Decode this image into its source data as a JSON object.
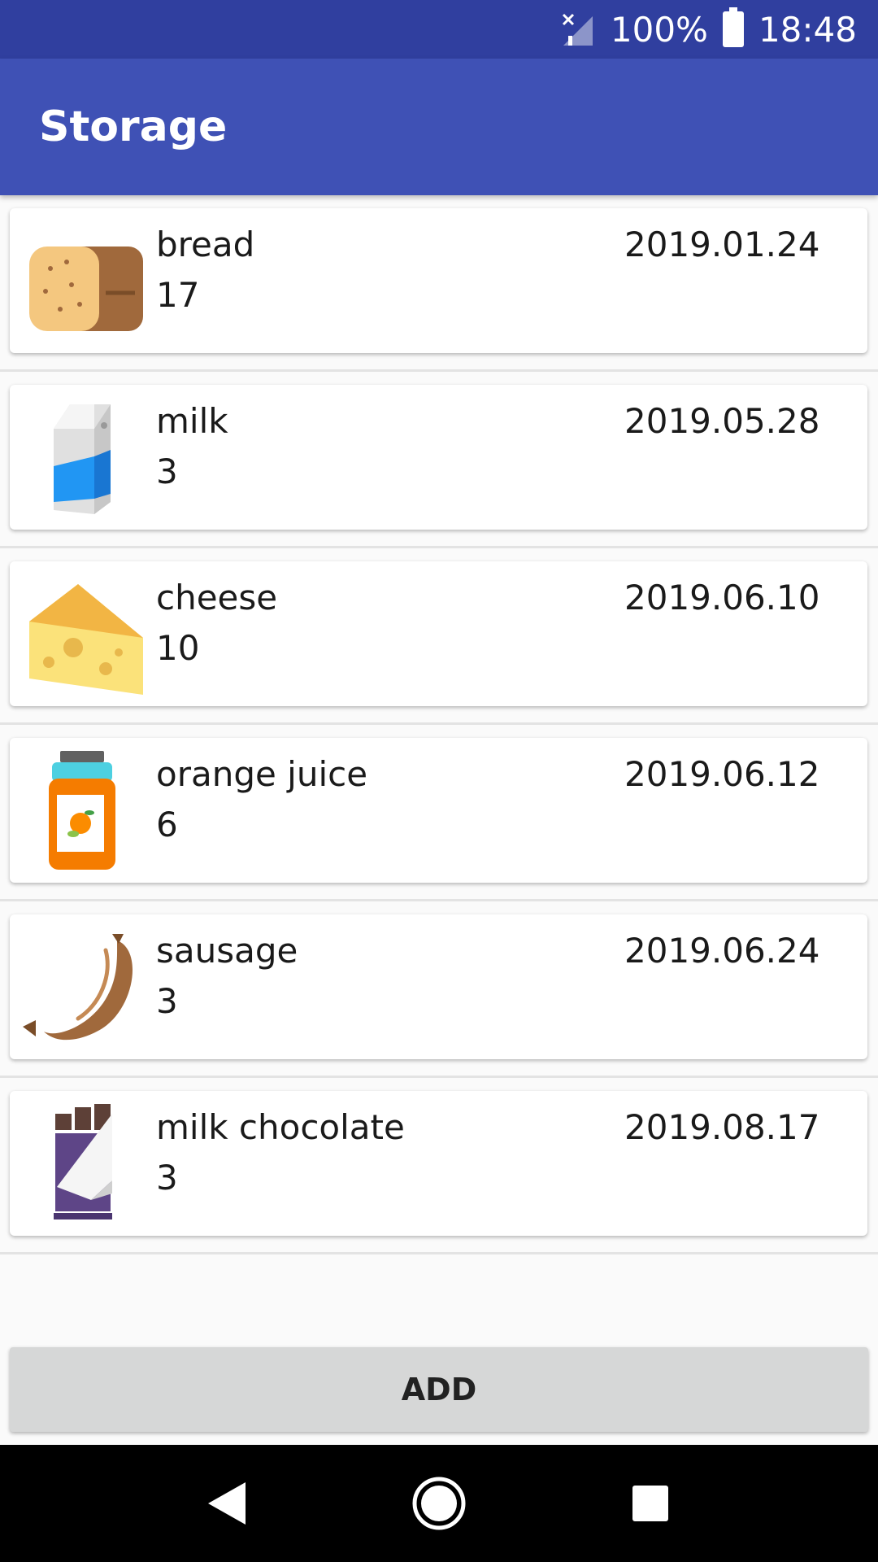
{
  "status_bar": {
    "battery": "100%",
    "time": "18:48"
  },
  "app_bar": {
    "title": "Storage"
  },
  "items": [
    {
      "name": "bread",
      "quantity": "17",
      "date": "2019.01.24",
      "icon": "bread-icon"
    },
    {
      "name": "milk",
      "quantity": "3",
      "date": "2019.05.28",
      "icon": "milk-carton-icon"
    },
    {
      "name": "cheese",
      "quantity": "10",
      "date": "2019.06.10",
      "icon": "cheese-icon"
    },
    {
      "name": "orange juice",
      "quantity": "6",
      "date": "2019.06.12",
      "icon": "orange-juice-jar-icon"
    },
    {
      "name": "sausage",
      "quantity": "3",
      "date": "2019.06.24",
      "icon": "sausage-icon"
    },
    {
      "name": "milk chocolate",
      "quantity": "3",
      "date": "2019.08.17",
      "icon": "chocolate-bar-icon"
    }
  ],
  "add_button": {
    "label": "ADD"
  },
  "colors": {
    "status_bar": "#303f9f",
    "app_bar": "#3f51b5",
    "button": "#d6d7d7"
  }
}
